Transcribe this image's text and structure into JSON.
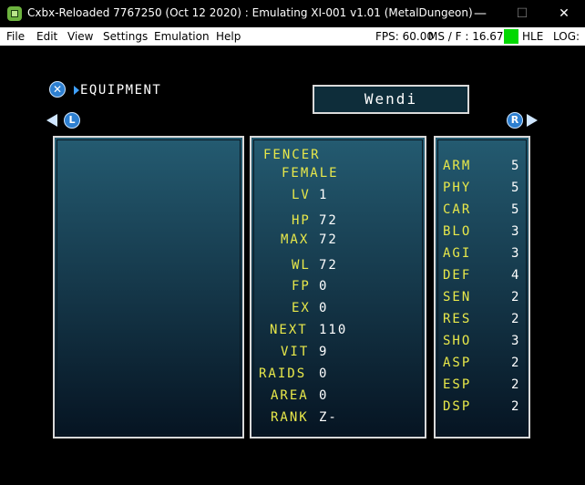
{
  "window": {
    "title": "Cxbx-Reloaded 7767250 (Oct 12 2020) : Emulating XI-001 v1.01 (MetalDungeon)",
    "minimize": "—",
    "maximize": "☐",
    "close": "✕"
  },
  "menu": {
    "items": [
      "File",
      "Edit",
      "View",
      "Settings",
      "Emulation",
      "Help"
    ]
  },
  "status": {
    "fps": "FPS: 60.00",
    "ms": "MS / F : 16.67",
    "hle": "HLE",
    "log": "LOG:",
    "hle_color": "#00d800"
  },
  "game": {
    "x_icon": "✕",
    "screen_title": "EQUIPMENT",
    "character_name": "Wendi",
    "l_button": "L",
    "r_button": "R",
    "profile": {
      "class": "FENCER",
      "gender": "FEMALE"
    },
    "stats": [
      {
        "label": "LV",
        "value": "1"
      },
      {
        "label": "HP",
        "value": "72"
      },
      {
        "label": "MAX",
        "value": "72"
      },
      {
        "label": "WL",
        "value": "72"
      },
      {
        "label": "FP",
        "value": "0"
      },
      {
        "label": "EX",
        "value": "0"
      },
      {
        "label": "NEXT",
        "value": "110"
      },
      {
        "label": "VIT",
        "value": "9"
      },
      {
        "label": "RAIDS",
        "value": "0"
      },
      {
        "label": "AREA",
        "value": "0"
      },
      {
        "label": "RANK",
        "value": "Z-"
      }
    ],
    "attributes": [
      {
        "label": "ARM",
        "value": "5"
      },
      {
        "label": "PHY",
        "value": "5"
      },
      {
        "label": "CAR",
        "value": "5"
      },
      {
        "label": "BLO",
        "value": "3"
      },
      {
        "label": "AGI",
        "value": "3"
      },
      {
        "label": "DEF",
        "value": "4"
      },
      {
        "label": "SEN",
        "value": "2"
      },
      {
        "label": "RES",
        "value": "2"
      },
      {
        "label": "SHO",
        "value": "3"
      },
      {
        "label": "ASP",
        "value": "2"
      },
      {
        "label": "ESP",
        "value": "2"
      },
      {
        "label": "DSP",
        "value": "2"
      }
    ]
  }
}
